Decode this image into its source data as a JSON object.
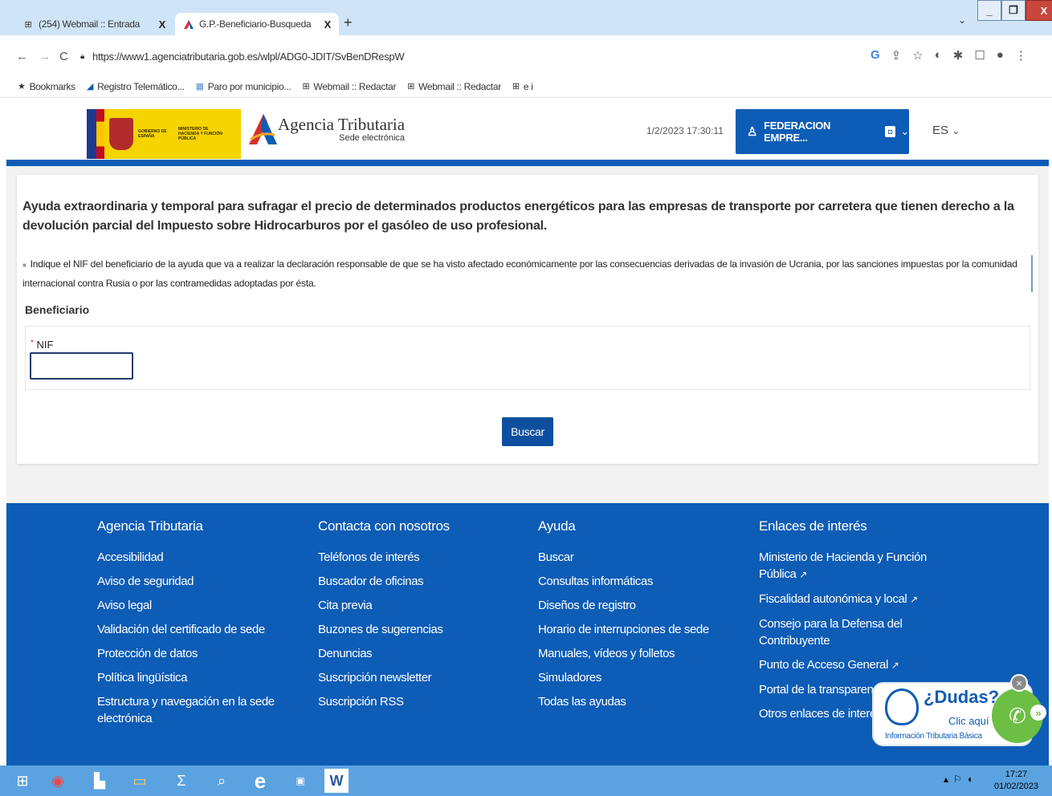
{
  "browser": {
    "tabs": [
      {
        "title": "(254) Webmail :: Entrada",
        "close": "X"
      },
      {
        "title": "G.P.-Beneficiario-Busqueda",
        "close": "X"
      }
    ],
    "new_tab": "+",
    "tab_menu": "⌄",
    "window_controls": {
      "minimize": "_",
      "maximize": "❐",
      "close": "X"
    },
    "url": "https://www1.agenciatributaria.gob.es/wlpl/ADG0-JDIT/SvBenDRespW",
    "bookmarks": [
      {
        "label": "Bookmarks",
        "icon": "star-icon"
      },
      {
        "label": "Registro Telemático...",
        "icon": "agencia-icon"
      },
      {
        "label": "Paro por municipio...",
        "icon": "chart-icon"
      },
      {
        "label": "Webmail :: Redactar",
        "icon": "mail-icon"
      },
      {
        "label": "Webmail :: Redactar",
        "icon": "mail-icon"
      },
      {
        "label": "e i",
        "icon": "mail-icon"
      }
    ]
  },
  "header": {
    "gov_text_1": "GOBIERNO DE ESPAÑA",
    "gov_text_2": "MINISTERIO DE HACIENDA Y FUNCIÓN PÚBLICA",
    "brand_title": "Agencia Tributaria",
    "brand_subtitle": "Sede electrónica",
    "datetime": "1/2/2023 17:30:11",
    "user": "FEDERACION EMPRE...",
    "lang": "ES"
  },
  "main": {
    "title": "Ayuda extraordinaria y temporal para sufragar el precio de determinados productos energéticos para las empresas de transporte por carretera que tienen derecho a la devolución parcial del Impuesto sobre Hidrocarburos por el gasóleo de uso profesional.",
    "info": "Indique el NIF del beneficiario de la ayuda que va a realizar la declaración responsable de que se ha visto afectado económicamente por las consecuencias derivadas de la invasión de Ucrania, por las sanciones impuestas por la comunidad internacional contra Rusia o por las contramedidas adoptadas por ésta.",
    "section": "Beneficiario",
    "nif_label": "NIF",
    "nif_required": "*",
    "nif_value": "",
    "search_button": "Buscar"
  },
  "footer": {
    "columns": [
      {
        "title": "Agencia Tributaria",
        "links": [
          "Accesibilidad",
          "Aviso de seguridad",
          "Aviso legal",
          "Validación del certificado de sede",
          "Protección de datos",
          "Política lingüística",
          "Estructura y navegación en la sede electrónica"
        ]
      },
      {
        "title": "Contacta con nosotros",
        "links": [
          "Teléfonos de interés",
          "Buscador de oficinas",
          "Cita previa",
          "Buzones de sugerencias",
          "Denuncias",
          "Suscripción newsletter",
          "Suscripción RSS"
        ]
      },
      {
        "title": "Ayuda",
        "links": [
          "Buscar",
          "Consultas informáticas",
          "Diseños de registro",
          "Horario de interrupciones de sede",
          "Manuales, vídeos y folletos",
          "Simuladores",
          "Todas las ayudas"
        ]
      },
      {
        "title": "Enlaces de interés",
        "links": [
          "Ministerio de Hacienda y Función Pública",
          "Fiscalidad autonómica y local",
          "Consejo para la Defensa del Contribuyente",
          "Punto de Acceso General",
          "Portal de la transparencia",
          "Otros enlaces de interés"
        ]
      }
    ]
  },
  "dudas": {
    "question": "¿Dudas?",
    "clic": "Clic aquí",
    "info": "Información Tributaria Básica"
  },
  "taskbar": {
    "time": "17:27",
    "date": "01/02/2023"
  },
  "colors": {
    "brand_blue": "#0d5cb6",
    "button_blue": "#0d4f9e",
    "gov_yellow": "#f5d400",
    "dudas_green": "#6cbe45"
  }
}
